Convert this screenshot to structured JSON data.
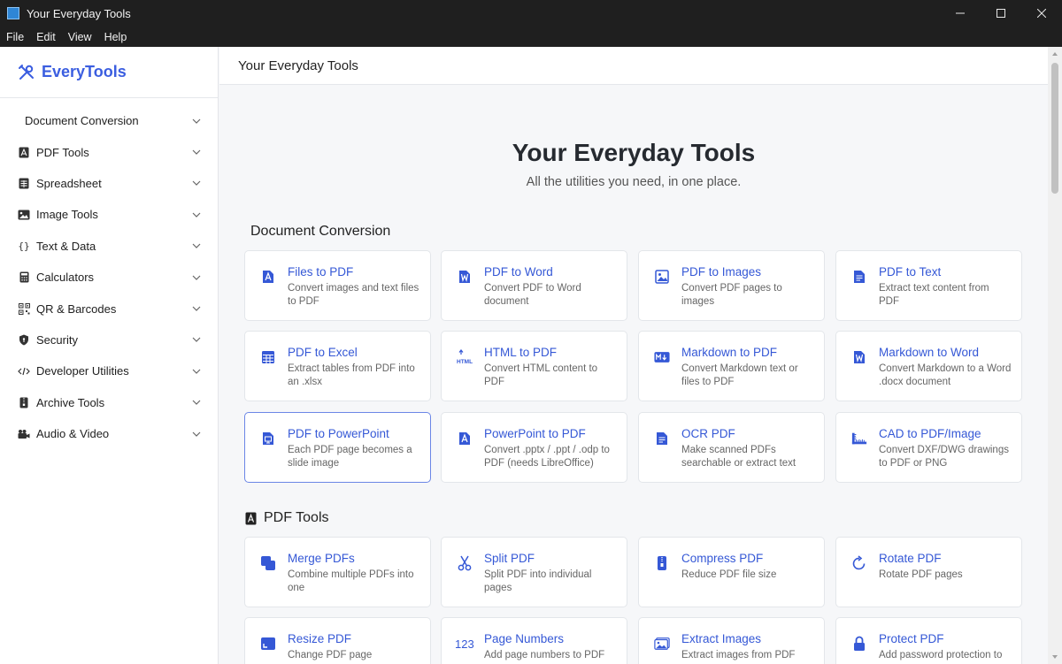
{
  "window": {
    "title": "Your Everyday Tools",
    "controls": {
      "minimize": "—",
      "maximize": "☐",
      "close": "✕"
    }
  },
  "menu": [
    "File",
    "Edit",
    "View",
    "Help"
  ],
  "brand": {
    "name": "EveryTools",
    "icon": "tools-icon",
    "color": "#3b5ee0"
  },
  "sidebar": {
    "items": [
      {
        "label": "Document Conversion",
        "icon": ""
      },
      {
        "label": "PDF Tools",
        "icon": "pdf-icon"
      },
      {
        "label": "Spreadsheet",
        "icon": "spreadsheet-icon"
      },
      {
        "label": "Image Tools",
        "icon": "image-icon"
      },
      {
        "label": "Text & Data",
        "icon": "braces-icon"
      },
      {
        "label": "Calculators",
        "icon": "calculator-icon"
      },
      {
        "label": "QR & Barcodes",
        "icon": "qr-icon"
      },
      {
        "label": "Security",
        "icon": "shield-icon"
      },
      {
        "label": "Developer Utilities",
        "icon": "code-icon"
      },
      {
        "label": "Archive Tools",
        "icon": "archive-icon"
      },
      {
        "label": "Audio & Video",
        "icon": "video-icon"
      }
    ]
  },
  "header": {
    "title": "Your Everyday Tools"
  },
  "hero": {
    "title": "Your Everyday Tools",
    "subtitle": "All the utilities you need, in one place."
  },
  "sections": [
    {
      "title": "Document Conversion",
      "cards": [
        {
          "title": "Files to PDF",
          "desc": "Convert images and text files to PDF",
          "icon": "pdf-icon"
        },
        {
          "title": "PDF to Word",
          "desc": "Convert PDF to Word document",
          "icon": "word-icon"
        },
        {
          "title": "PDF to Images",
          "desc": "Convert PDF pages to images",
          "icon": "image-icon"
        },
        {
          "title": "PDF to Text",
          "desc": "Extract text content from PDF",
          "icon": "text-file-icon"
        },
        {
          "title": "PDF to Excel",
          "desc": "Extract tables from PDF into an .xlsx",
          "icon": "table-icon"
        },
        {
          "title": "HTML to PDF",
          "desc": "Convert HTML content to PDF",
          "icon": "html-icon"
        },
        {
          "title": "Markdown to PDF",
          "desc": "Convert Markdown text or files to PDF",
          "icon": "markdown-icon"
        },
        {
          "title": "Markdown to Word",
          "desc": "Convert Markdown to a Word .docx document",
          "icon": "word-icon"
        },
        {
          "title": "PDF to PowerPoint",
          "desc": "Each PDF page becomes a slide image",
          "icon": "powerpoint-icon",
          "active": true
        },
        {
          "title": "PowerPoint to PDF",
          "desc": "Convert .pptx / .ppt / .odp to PDF (needs LibreOffice)",
          "icon": "pdf-icon"
        },
        {
          "title": "OCR PDF",
          "desc": "Make scanned PDFs searchable or extract text",
          "icon": "text-file-icon"
        },
        {
          "title": "CAD to PDF/Image",
          "desc": "Convert DXF/DWG drawings to PDF or PNG",
          "icon": "ruler-icon"
        }
      ]
    },
    {
      "title": "PDF Tools",
      "icon": "pdf-icon",
      "cards": [
        {
          "title": "Merge PDFs",
          "desc": "Combine multiple PDFs into one",
          "icon": "merge-icon"
        },
        {
          "title": "Split PDF",
          "desc": "Split PDF into individual pages",
          "icon": "scissors-icon"
        },
        {
          "title": "Compress PDF",
          "desc": "Reduce PDF file size",
          "icon": "compress-icon"
        },
        {
          "title": "Rotate PDF",
          "desc": "Rotate PDF pages",
          "icon": "rotate-icon"
        },
        {
          "title": "Resize PDF",
          "desc": "Change PDF page",
          "icon": "resize-icon"
        },
        {
          "title": "Page Numbers",
          "desc": "Add page numbers to PDF",
          "icon": "numbers-icon"
        },
        {
          "title": "Extract Images",
          "desc": "Extract images from PDF",
          "icon": "images-icon"
        },
        {
          "title": "Protect PDF",
          "desc": "Add password protection to",
          "icon": "lock-icon"
        }
      ]
    }
  ],
  "colors": {
    "accent": "#3558d6",
    "active_border": "#6b86e6"
  }
}
